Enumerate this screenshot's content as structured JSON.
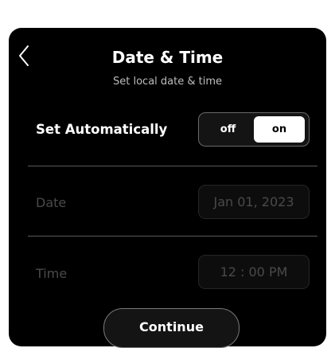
{
  "header": {
    "title": "Date & Time",
    "subtitle": "Set local date & time",
    "back_icon": "chevron-left-icon"
  },
  "set_automatically": {
    "label": "Set Automatically",
    "options": [
      "off",
      "on"
    ],
    "selected": "on"
  },
  "date": {
    "label": "Date",
    "value": "Jan 01, 2023"
  },
  "time": {
    "label": "Time",
    "value": "12 : 00 PM"
  },
  "continue_label": "Continue",
  "colors": {
    "background": "#000000",
    "text_primary": "#ffffff",
    "text_disabled": "#4a4a4a",
    "toggle_selected": "#ffffff"
  }
}
